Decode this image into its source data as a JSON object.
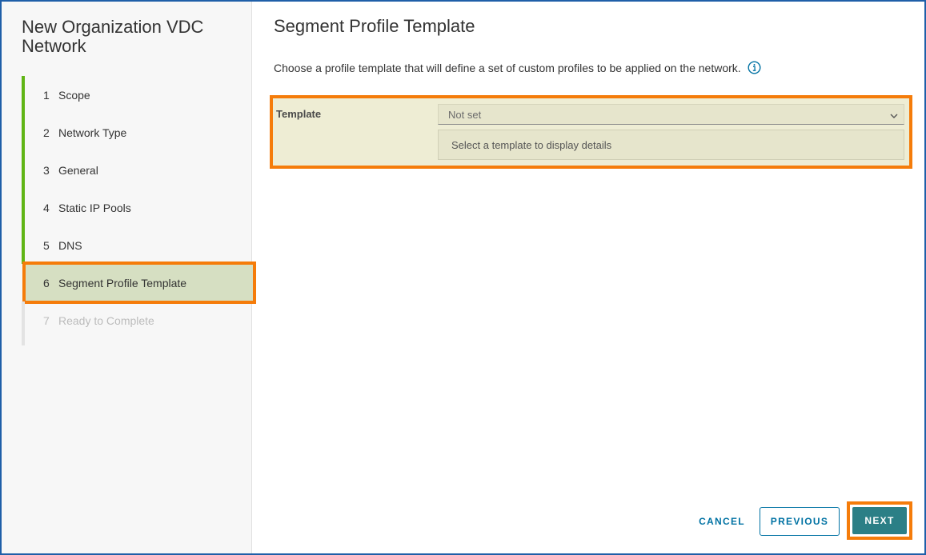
{
  "wizard": {
    "title": "New Organization VDC Network",
    "steps": [
      {
        "number": "1",
        "label": "Scope",
        "state": "complete"
      },
      {
        "number": "2",
        "label": "Network Type",
        "state": "complete"
      },
      {
        "number": "3",
        "label": "General",
        "state": "complete"
      },
      {
        "number": "4",
        "label": "Static IP Pools",
        "state": "complete"
      },
      {
        "number": "5",
        "label": "DNS",
        "state": "complete"
      },
      {
        "number": "6",
        "label": "Segment Profile Template",
        "state": "current"
      },
      {
        "number": "7",
        "label": "Ready to Complete",
        "state": "pending"
      }
    ]
  },
  "main": {
    "title": "Segment Profile Template",
    "description": "Choose a profile template that will define a set of custom profiles to be applied on the network.",
    "info_icon": "info-circle-icon",
    "template": {
      "label": "Template",
      "selected_value": "Not set",
      "details_placeholder": "Select a template to display details"
    }
  },
  "footer": {
    "cancel_label": "CANCEL",
    "previous_label": "PREVIOUS",
    "next_label": "NEXT"
  },
  "colors": {
    "accent": "#0072a3",
    "primary_button": "#2b7f86",
    "complete_step": "#60b515",
    "highlight": "#f57c0a",
    "frame": "#1f5fa8"
  }
}
